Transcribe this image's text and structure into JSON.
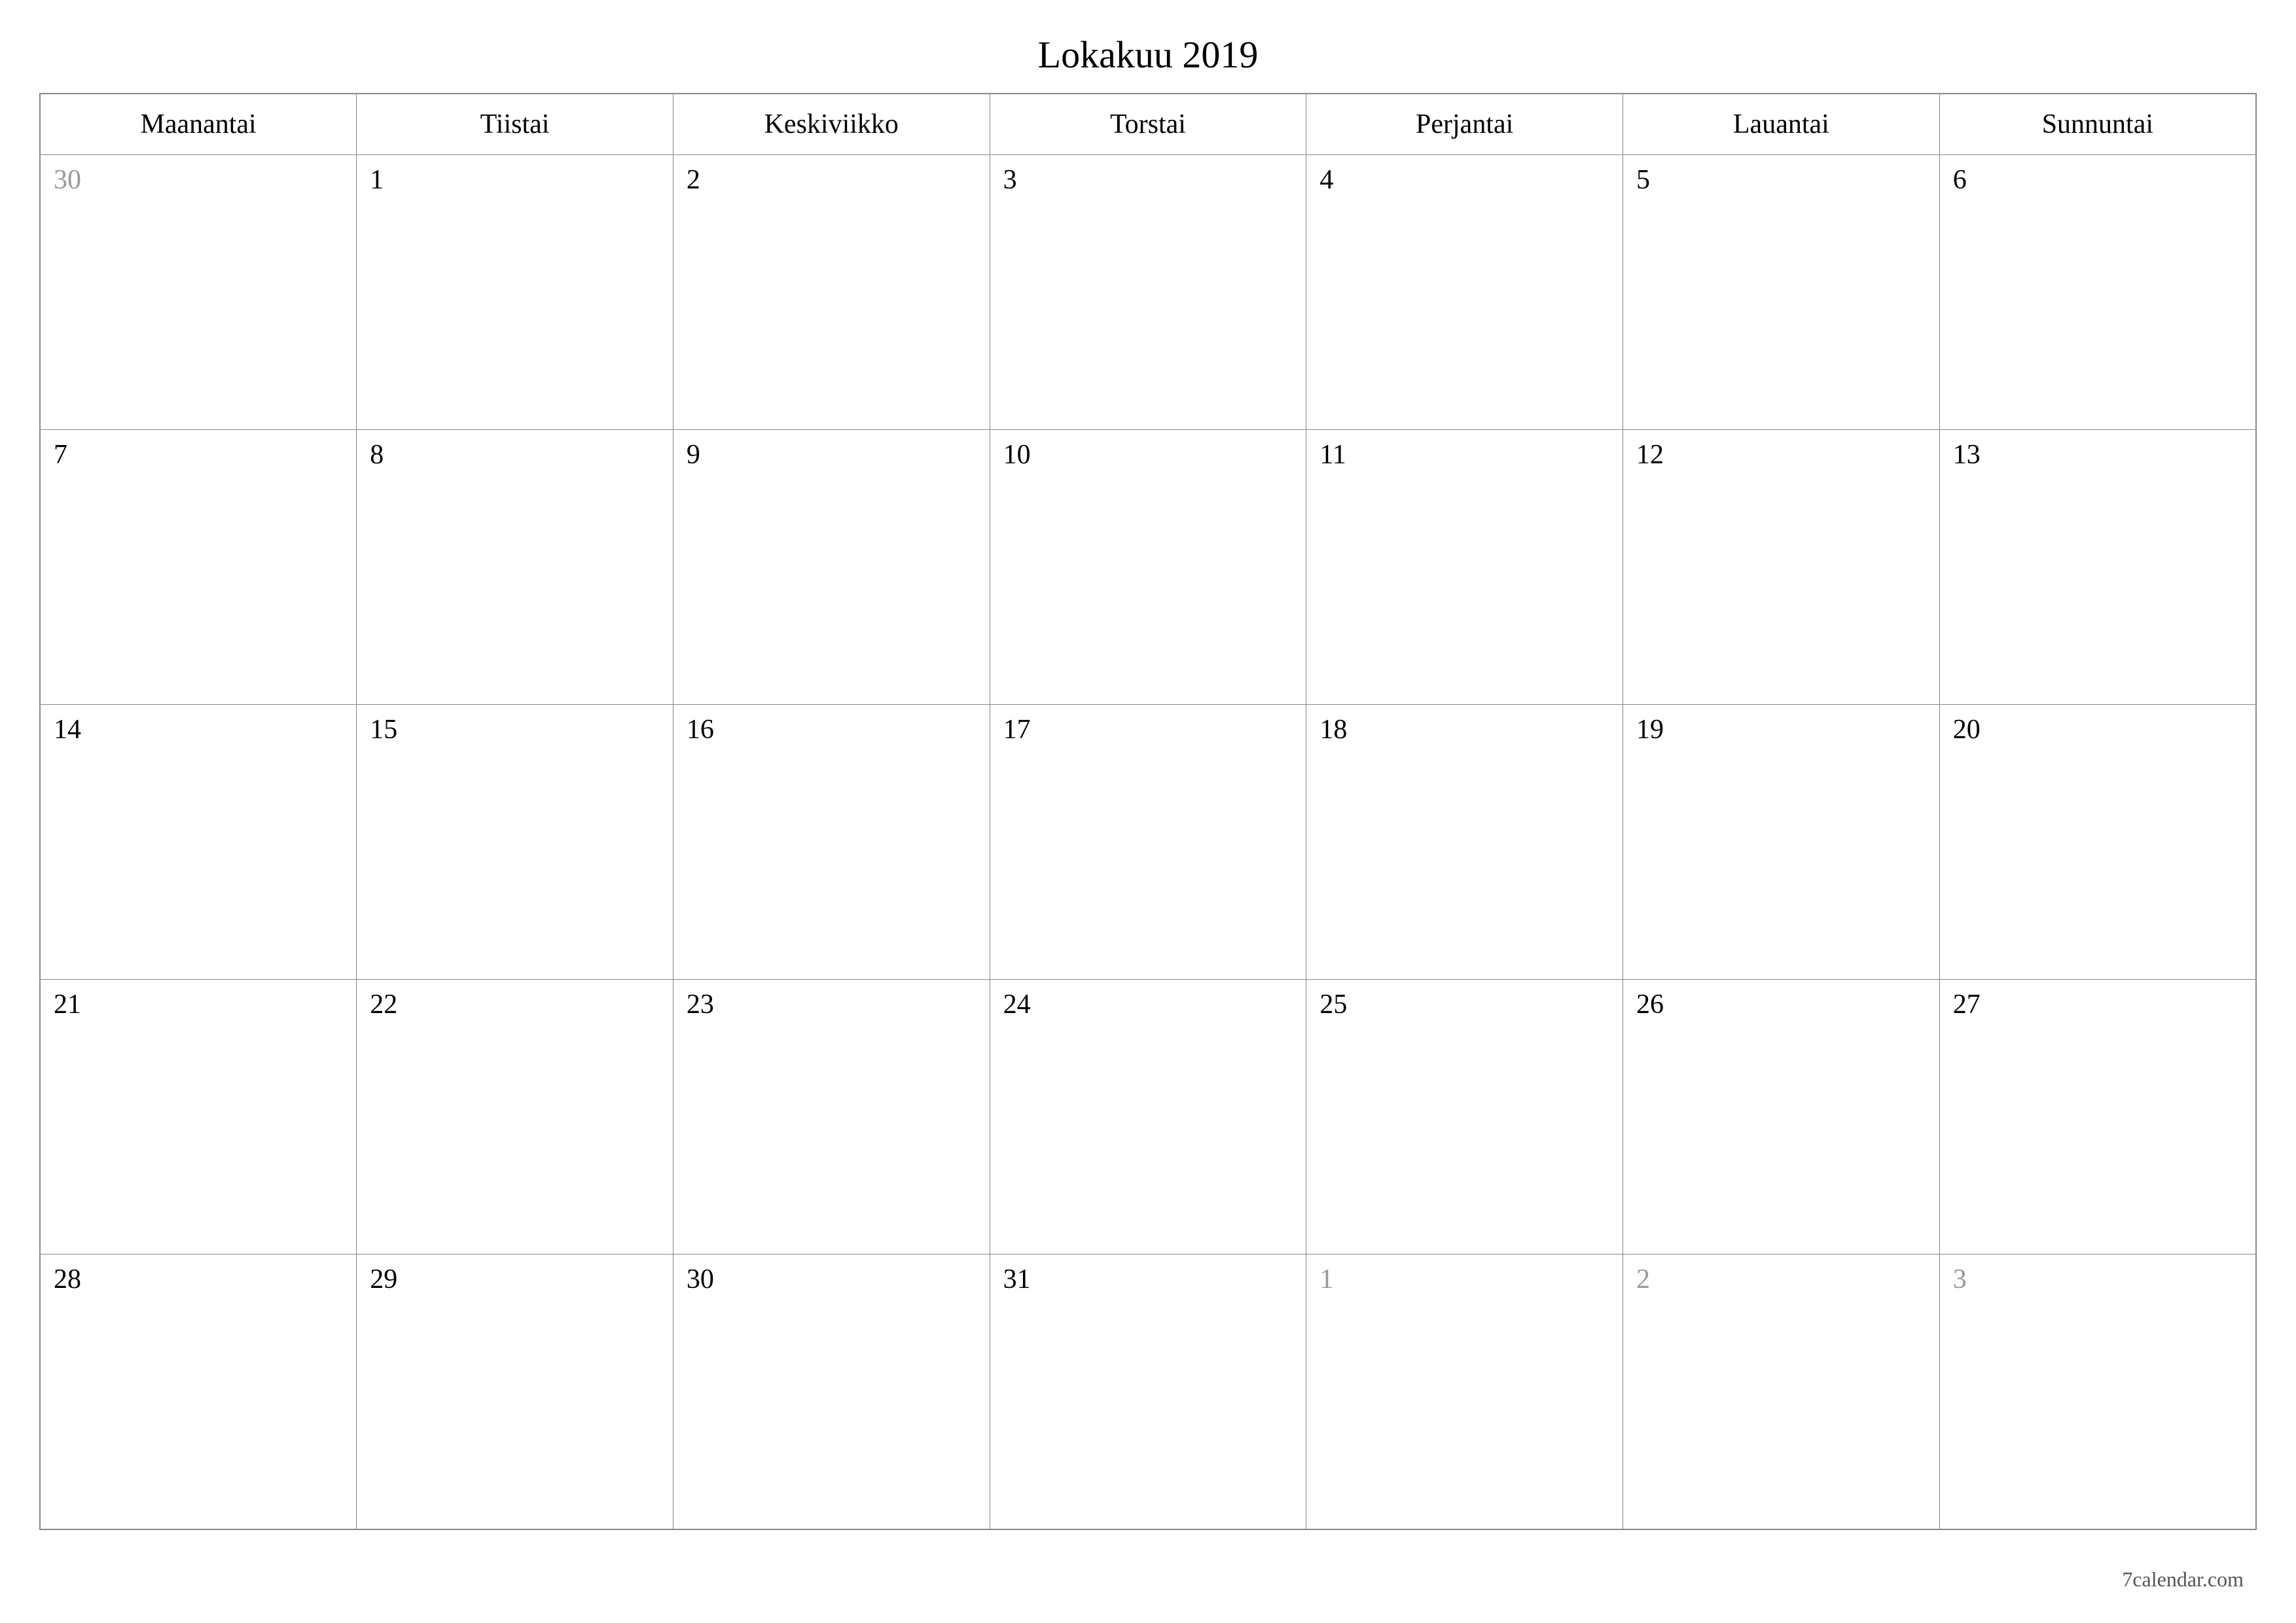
{
  "title": "Lokakuu 2019",
  "watermark": "7calendar.com",
  "weekdays": [
    "Maanantai",
    "Tiistai",
    "Keskiviikko",
    "Torstai",
    "Perjantai",
    "Lauantai",
    "Sunnuntai"
  ],
  "weeks": [
    [
      {
        "day": "30",
        "other": true
      },
      {
        "day": "1",
        "other": false
      },
      {
        "day": "2",
        "other": false
      },
      {
        "day": "3",
        "other": false
      },
      {
        "day": "4",
        "other": false
      },
      {
        "day": "5",
        "other": false
      },
      {
        "day": "6",
        "other": false
      }
    ],
    [
      {
        "day": "7",
        "other": false
      },
      {
        "day": "8",
        "other": false
      },
      {
        "day": "9",
        "other": false
      },
      {
        "day": "10",
        "other": false
      },
      {
        "day": "11",
        "other": false
      },
      {
        "day": "12",
        "other": false
      },
      {
        "day": "13",
        "other": false
      }
    ],
    [
      {
        "day": "14",
        "other": false
      },
      {
        "day": "15",
        "other": false
      },
      {
        "day": "16",
        "other": false
      },
      {
        "day": "17",
        "other": false
      },
      {
        "day": "18",
        "other": false
      },
      {
        "day": "19",
        "other": false
      },
      {
        "day": "20",
        "other": false
      }
    ],
    [
      {
        "day": "21",
        "other": false
      },
      {
        "day": "22",
        "other": false
      },
      {
        "day": "23",
        "other": false
      },
      {
        "day": "24",
        "other": false
      },
      {
        "day": "25",
        "other": false
      },
      {
        "day": "26",
        "other": false
      },
      {
        "day": "27",
        "other": false
      }
    ],
    [
      {
        "day": "28",
        "other": false
      },
      {
        "day": "29",
        "other": false
      },
      {
        "day": "30",
        "other": false
      },
      {
        "day": "31",
        "other": false
      },
      {
        "day": "1",
        "other": true
      },
      {
        "day": "2",
        "other": true
      },
      {
        "day": "3",
        "other": true
      }
    ]
  ]
}
